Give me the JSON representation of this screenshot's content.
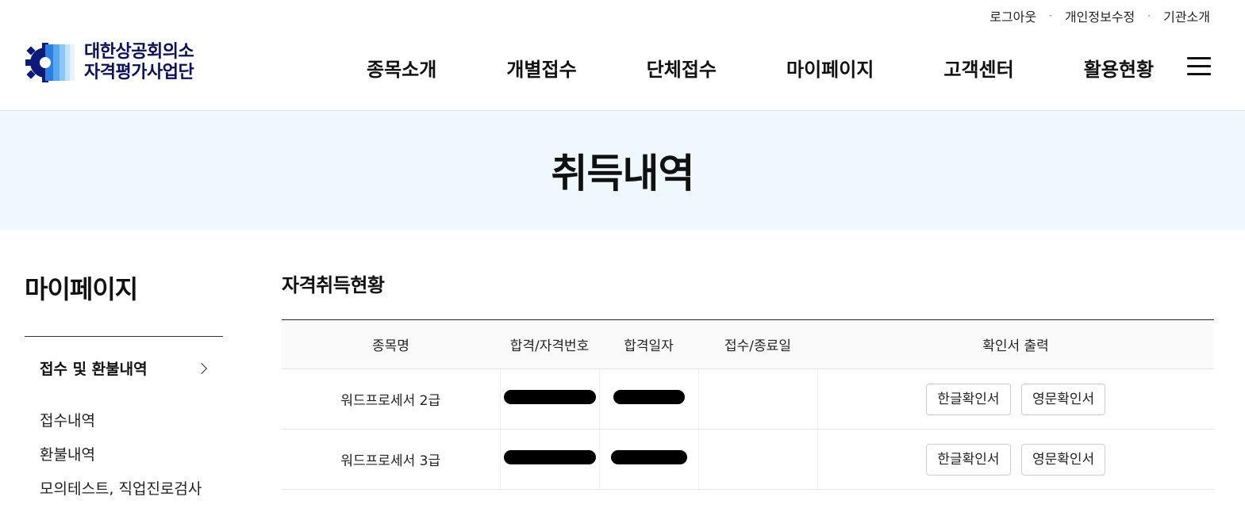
{
  "util_links": [
    "로그아웃",
    "개인정보수정",
    "기관소개"
  ],
  "logo": {
    "line1": "대한상공회의소",
    "line2": "자격평가사업단"
  },
  "gnb": [
    "종목소개",
    "개별접수",
    "단체접수",
    "마이페이지",
    "고객센터",
    "활용현황"
  ],
  "banner": {
    "title": "취득내역"
  },
  "side": {
    "title": "마이페이지",
    "group": "접수 및 환불내역",
    "items": [
      "접수내역",
      "환불내역",
      "모의테스트, 직업진로검사"
    ]
  },
  "content": {
    "title": "자격취득현황",
    "columns": [
      "종목명",
      "합격/자격번호",
      "합격일자",
      "접수/종료일",
      "확인서 출력"
    ],
    "rows": [
      {
        "name": "워드프로세서 2급",
        "korean_btn": "한글확인서",
        "english_btn": "영문확인서"
      },
      {
        "name": "워드프로세서 3급",
        "korean_btn": "한글확인서",
        "english_btn": "영문확인서"
      }
    ]
  },
  "colors": {
    "banner_bg": "#eef8fd",
    "logo_blue": "#0b0f5e"
  }
}
